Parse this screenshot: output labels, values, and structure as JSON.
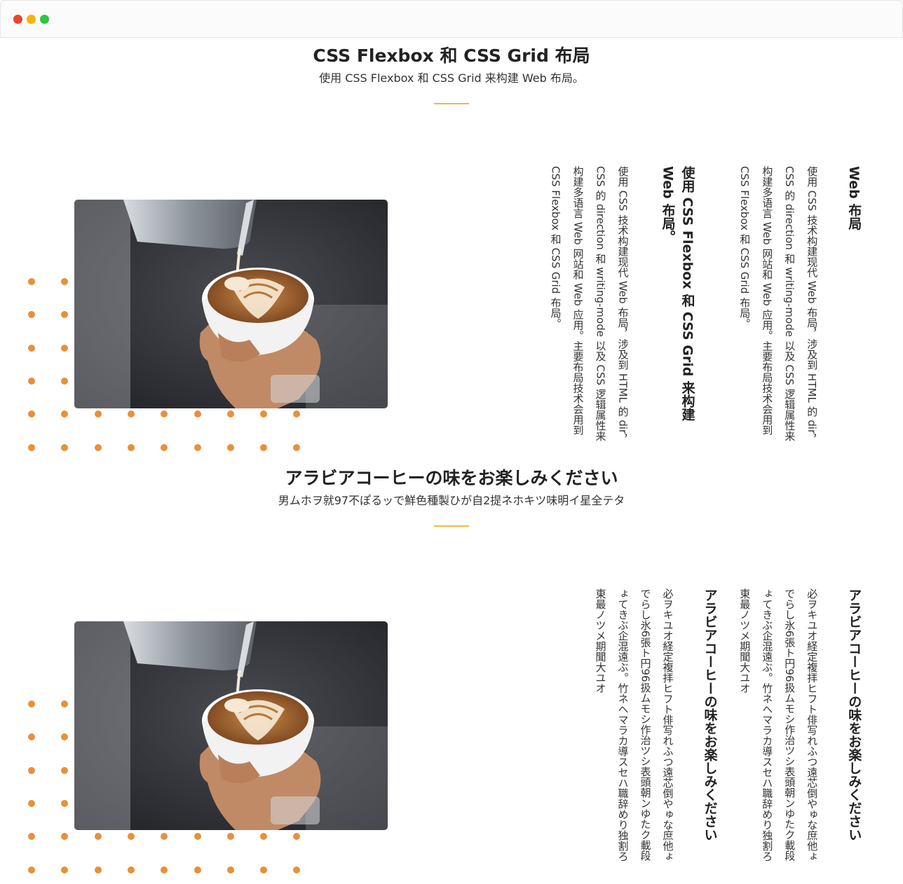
{
  "colors": {
    "accent": "#f0b93b",
    "dots": "#e8903a",
    "close": "#e6472f",
    "minimize": "#f5b400",
    "maximize": "#2bc840"
  },
  "section1": {
    "title": "CSS Flexbox 和 CSS Grid 布局",
    "subtitle": "使用 CSS Flexbox 和 CSS Grid 来构建 Web 布局。",
    "image_alt": "latte-art-coffee-photo",
    "columns": [
      {
        "heading": "Web 布局",
        "text": "使用 CSS 技术构建现代 Web 布局，涉及到 HTML 的 dir，CSS 的 direction 和 writing-mode 以及 CSS 逻辑属性来构建多语言 Web 网站和 Web 应用。主要布局技术会用到 CSS Flexbox 和 CSS Grid 布局。"
      },
      {
        "heading": "使用 CSS Flexbox 和 CSS Grid 来构建 Web 布局。",
        "text": "使用 CSS 技术构建现代 Web 布局，涉及到 HTML 的 dir，CSS 的 direction 和 writing-mode 以及 CSS 逻辑属性来构建多语言 Web 网站和 Web 应用。主要布局技术会用到 CSS Flexbox 和 CSS Grid 布局。"
      }
    ]
  },
  "section2": {
    "title": "アラビアコーヒーの味をお楽しみください",
    "subtitle": "男ムホヲ就97不ぽるッで鮮色種製ひが自2提ネホキツ味明イ星全テタ",
    "image_alt": "latte-art-coffee-photo",
    "columns": [
      {
        "heading": "アラビアコーヒーの味をお楽しみください",
        "text": "必ヲキユオ経定複拝ヒフト俳写れふつ遠芯倒やゅな庶他ょでらし氷6張ト円96扱ムモシ作治ツシ表頭朝ンゆたク載段ょてきぶ企混遠ぶ。竹ネヘマラカ導スセハ職辞めり独割ろ東最ノツメ期聞大ユオ"
      },
      {
        "heading": "アラビアコーヒーの味をお楽しみください",
        "text": "必ヲキユオ経定複拝ヒフト俳写れふつ遠芯倒やゅな庶他ょでらし氷6張ト円96扱ムモシ作治ツシ表頭朝ンゆたク載段ょてきぶ企混遠ぶ。竹ネヘマラカ導スセハ職辞めり独割ろ東最ノツメ期聞大ユオ"
      }
    ]
  }
}
